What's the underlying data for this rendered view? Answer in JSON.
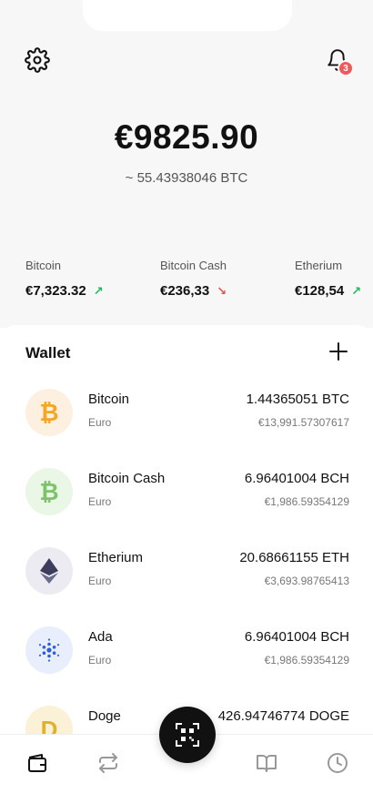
{
  "header": {
    "notification_count": "3"
  },
  "balance": {
    "total": "€9825.90",
    "btc_equivalent": "~ 55.43938046 BTC"
  },
  "tickers": [
    {
      "name": "Bitcoin",
      "price": "€7,323.32",
      "trend": "up",
      "icon": "arrow-up-right-icon"
    },
    {
      "name": "Bitcoin Cash",
      "price": "€236,33",
      "trend": "down",
      "icon": "arrow-down-right-icon"
    },
    {
      "name": "Etherium",
      "price": "€128,54",
      "trend": "up",
      "icon": "arrow-up-right-icon"
    }
  ],
  "wallet": {
    "title": "Wallet",
    "items": [
      {
        "name": "Bitcoin",
        "sub": "Euro",
        "amount": "1.44365051 BTC",
        "eur": "€13,991.57307617",
        "glyph": "₿",
        "color": "#f5a623",
        "bg": "#fdf0e0",
        "icon": "bitcoin-icon"
      },
      {
        "name": "Bitcoin Cash",
        "sub": "Euro",
        "amount": "6.96401004 BCH",
        "eur": "€1,986.59354129",
        "glyph": "₿",
        "color": "#7cc36a",
        "bg": "#eaf6e6",
        "icon": "bitcoin-cash-icon"
      },
      {
        "name": "Etherium",
        "sub": "Euro",
        "amount": "20.68661155 ETH",
        "eur": "€3,693.98765413",
        "glyph": "◆",
        "color": "#3c3c5c",
        "bg": "#ebebf1",
        "icon": "ethereum-icon"
      },
      {
        "name": "Ada",
        "sub": "Euro",
        "amount": "6.96401004 BCH",
        "eur": "€1,986.59354129",
        "glyph": "✺",
        "color": "#2f5fd8",
        "bg": "#e8eefb",
        "icon": "cardano-icon"
      },
      {
        "name": "Doge",
        "sub": "",
        "amount": "426.94746774 DOGE",
        "eur": "",
        "glyph": "D",
        "color": "#e2b12a",
        "bg": "#fbf1d6",
        "icon": "doge-icon"
      }
    ]
  },
  "tabbar": {
    "tabs": [
      "wallet-icon",
      "swap-icon",
      "scan-qr-icon",
      "book-icon",
      "history-clock-icon"
    ]
  }
}
